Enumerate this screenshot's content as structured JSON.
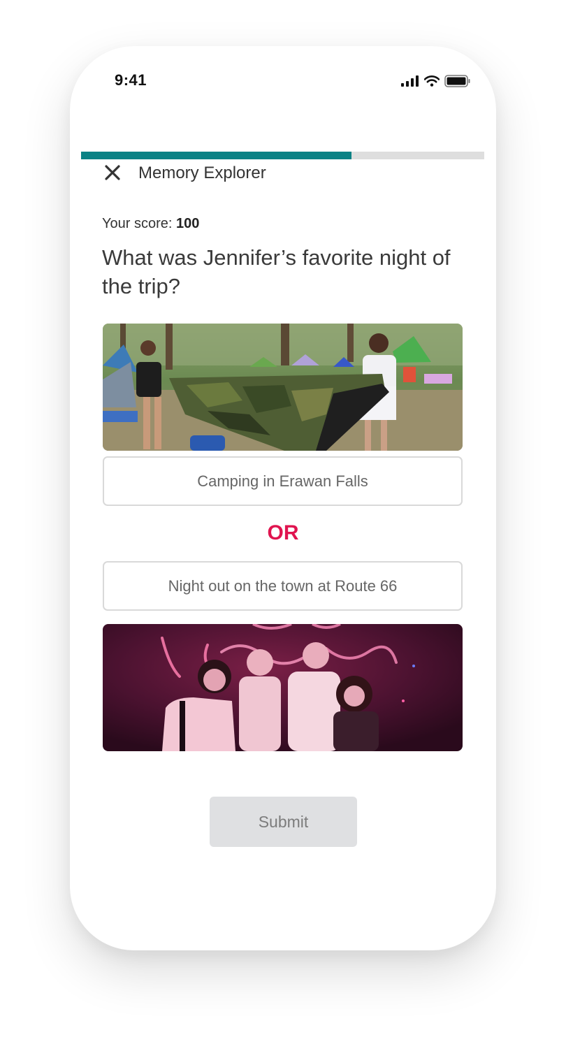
{
  "status_bar": {
    "time": "9:41"
  },
  "header": {
    "title": "Memory Explorer"
  },
  "progress": {
    "fraction": 0.67
  },
  "quiz": {
    "score_label": "Your score:",
    "score_value": "100",
    "question": "What was Jennifer’s favorite night of the trip?",
    "option_a": "Camping in Erawan Falls",
    "separator": "OR",
    "option_b": "Night out on the town at Route 66"
  },
  "submit": {
    "label": "Submit"
  },
  "colors": {
    "accent_teal": "#0b8285",
    "or_red": "#e0144f",
    "progress_track": "#dedede",
    "submit_disabled_bg": "#dfe0e2"
  }
}
